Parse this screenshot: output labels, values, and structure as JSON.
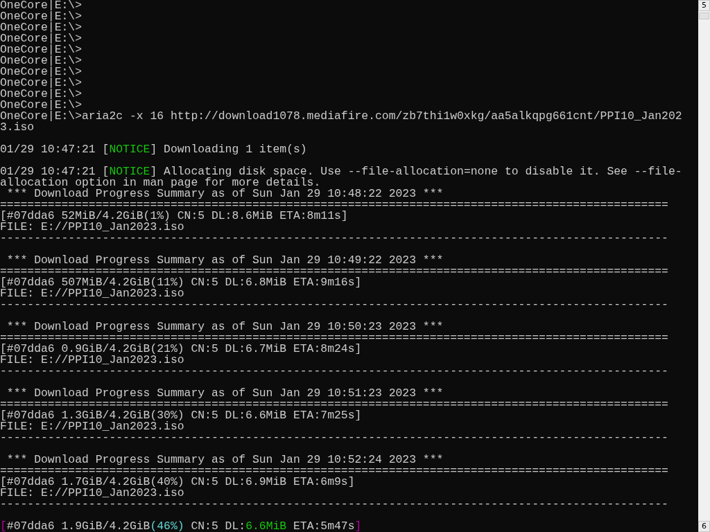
{
  "terminal": {
    "lines": [
      {
        "kind": "text",
        "segments": [
          {
            "text": "OneCore|E:\\>"
          }
        ]
      },
      {
        "kind": "text",
        "segments": [
          {
            "text": "OneCore|E:\\>"
          }
        ]
      },
      {
        "kind": "text",
        "segments": [
          {
            "text": "OneCore|E:\\>"
          }
        ]
      },
      {
        "kind": "text",
        "segments": [
          {
            "text": "OneCore|E:\\>"
          }
        ]
      },
      {
        "kind": "text",
        "segments": [
          {
            "text": "OneCore|E:\\>"
          }
        ]
      },
      {
        "kind": "text",
        "segments": [
          {
            "text": "OneCore|E:\\>"
          }
        ]
      },
      {
        "kind": "text",
        "segments": [
          {
            "text": "OneCore|E:\\>"
          }
        ]
      },
      {
        "kind": "text",
        "segments": [
          {
            "text": "OneCore|E:\\>"
          }
        ]
      },
      {
        "kind": "text",
        "segments": [
          {
            "text": "OneCore|E:\\>"
          }
        ]
      },
      {
        "kind": "text",
        "segments": [
          {
            "text": "OneCore|E:\\>"
          }
        ]
      },
      {
        "kind": "text",
        "segments": [
          {
            "text": "OneCore|E:\\>aria2c -x 16 http://download1078.mediafire.com/zb7thi1w0xkg/aa5alkqpg661cnt/PPI10_Jan202"
          }
        ]
      },
      {
        "kind": "text",
        "segments": [
          {
            "text": "3.iso"
          }
        ]
      },
      {
        "kind": "blank"
      },
      {
        "kind": "text",
        "segments": [
          {
            "text": "01/29 10:47:21 ["
          },
          {
            "text": "NOTICE",
            "color": "#16c60c"
          },
          {
            "text": "] Downloading 1 item(s)"
          }
        ]
      },
      {
        "kind": "blank"
      },
      {
        "kind": "text",
        "segments": [
          {
            "text": "01/29 10:47:21 ["
          },
          {
            "text": "NOTICE",
            "color": "#16c60c"
          },
          {
            "text": "] Allocating disk space. Use --file-allocation=none to disable it. See --file-"
          }
        ]
      },
      {
        "kind": "text",
        "segments": [
          {
            "text": "allocation option in man page for more details."
          }
        ]
      },
      {
        "kind": "text",
        "segments": [
          {
            "text": " *** Download Progress Summary as of Sun Jan 29 10:48:22 2023 ***"
          }
        ]
      },
      {
        "kind": "text",
        "segments": [
          {
            "text": "=================================================================================================="
          }
        ]
      },
      {
        "kind": "text",
        "segments": [
          {
            "text": "[#07dda6 52MiB/4.2GiB(1%) CN:5 DL:8.6MiB ETA:8m11s]"
          }
        ]
      },
      {
        "kind": "text",
        "segments": [
          {
            "text": "FILE: E://PPI10_Jan2023.iso"
          }
        ]
      },
      {
        "kind": "text",
        "segments": [
          {
            "text": "--------------------------------------------------------------------------------------------------"
          }
        ]
      },
      {
        "kind": "blank"
      },
      {
        "kind": "text",
        "segments": [
          {
            "text": " *** Download Progress Summary as of Sun Jan 29 10:49:22 2023 ***"
          }
        ]
      },
      {
        "kind": "text",
        "segments": [
          {
            "text": "=================================================================================================="
          }
        ]
      },
      {
        "kind": "text",
        "segments": [
          {
            "text": "[#07dda6 507MiB/4.2GiB(11%) CN:5 DL:6.8MiB ETA:9m16s]"
          }
        ]
      },
      {
        "kind": "text",
        "segments": [
          {
            "text": "FILE: E://PPI10_Jan2023.iso"
          }
        ]
      },
      {
        "kind": "text",
        "segments": [
          {
            "text": "--------------------------------------------------------------------------------------------------"
          }
        ]
      },
      {
        "kind": "blank"
      },
      {
        "kind": "text",
        "segments": [
          {
            "text": " *** Download Progress Summary as of Sun Jan 29 10:50:23 2023 ***"
          }
        ]
      },
      {
        "kind": "text",
        "segments": [
          {
            "text": "=================================================================================================="
          }
        ]
      },
      {
        "kind": "text",
        "segments": [
          {
            "text": "[#07dda6 0.9GiB/4.2GiB(21%) CN:5 DL:6.7MiB ETA:8m24s]"
          }
        ]
      },
      {
        "kind": "text",
        "segments": [
          {
            "text": "FILE: E://PPI10_Jan2023.iso"
          }
        ]
      },
      {
        "kind": "text",
        "segments": [
          {
            "text": "--------------------------------------------------------------------------------------------------"
          }
        ]
      },
      {
        "kind": "blank"
      },
      {
        "kind": "text",
        "segments": [
          {
            "text": " *** Download Progress Summary as of Sun Jan 29 10:51:23 2023 ***"
          }
        ]
      },
      {
        "kind": "text",
        "segments": [
          {
            "text": "=================================================================================================="
          }
        ]
      },
      {
        "kind": "text",
        "segments": [
          {
            "text": "[#07dda6 1.3GiB/4.2GiB(30%) CN:5 DL:6.6MiB ETA:7m25s]"
          }
        ]
      },
      {
        "kind": "text",
        "segments": [
          {
            "text": "FILE: E://PPI10_Jan2023.iso"
          }
        ]
      },
      {
        "kind": "text",
        "segments": [
          {
            "text": "--------------------------------------------------------------------------------------------------"
          }
        ]
      },
      {
        "kind": "blank"
      },
      {
        "kind": "text",
        "segments": [
          {
            "text": " *** Download Progress Summary as of Sun Jan 29 10:52:24 2023 ***"
          }
        ]
      },
      {
        "kind": "text",
        "segments": [
          {
            "text": "=================================================================================================="
          }
        ]
      },
      {
        "kind": "text",
        "segments": [
          {
            "text": "[#07dda6 1.7GiB/4.2GiB(40%) CN:5 DL:6.9MiB ETA:6m9s]"
          }
        ]
      },
      {
        "kind": "text",
        "segments": [
          {
            "text": "FILE: E://PPI10_Jan2023.iso"
          }
        ]
      },
      {
        "kind": "text",
        "segments": [
          {
            "text": "--------------------------------------------------------------------------------------------------"
          }
        ]
      },
      {
        "kind": "blank"
      },
      {
        "kind": "text",
        "segments": [
          {
            "text": "[",
            "color": "#b4009e"
          },
          {
            "text": "#07dda6 1.9GiB/4.2GiB"
          },
          {
            "text": "(46%)",
            "color": "#61d6d6"
          },
          {
            "text": " CN:5 DL:"
          },
          {
            "text": "6.6MiB",
            "color": "#16c60c"
          },
          {
            "text": " ETA:5m47s"
          },
          {
            "text": "]",
            "color": "#b4009e"
          }
        ]
      }
    ]
  },
  "scrollbar": {
    "up_glyph": "5",
    "down_glyph": "6"
  }
}
